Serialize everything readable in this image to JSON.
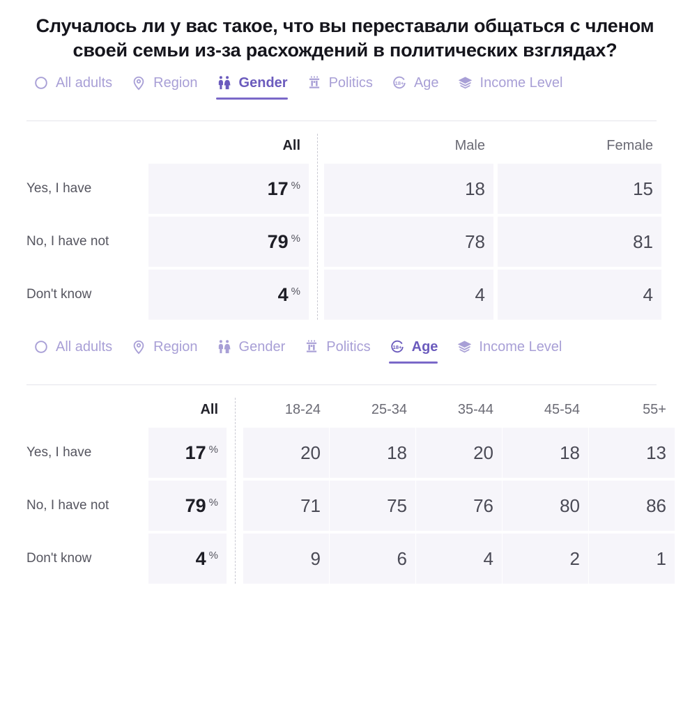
{
  "page": {
    "title": "Случалось ли у вас такое, что вы переставали общаться с членом своей семьи из-за расхождений в политических взглядах?",
    "accent_color": "#6b5bbd",
    "inactive_color": "#a89fd6",
    "cell_bg": "#f6f5fa"
  },
  "tabs": [
    {
      "label": "All adults",
      "icon": "circle-icon",
      "active": false
    },
    {
      "label": "Region",
      "icon": "map-pin-icon",
      "active": false
    },
    {
      "label": "Gender",
      "icon": "gender-people-icon",
      "active": true
    },
    {
      "label": "Politics",
      "icon": "capitol-building-icon",
      "active": false
    },
    {
      "label": "Age",
      "icon": "age-18plus-icon",
      "active": false
    },
    {
      "label": "Income Level",
      "icon": "graduation-cap-icon",
      "active": false
    }
  ],
  "tabs2": [
    {
      "label": "All adults",
      "icon": "circle-icon",
      "active": false
    },
    {
      "label": "Region",
      "icon": "map-pin-icon",
      "active": false
    },
    {
      "label": "Gender",
      "icon": "gender-people-icon",
      "active": false
    },
    {
      "label": "Politics",
      "icon": "capitol-building-icon",
      "active": false
    },
    {
      "label": "Age",
      "icon": "age-18plus-icon",
      "active": true
    },
    {
      "label": "Income Level",
      "icon": "graduation-cap-icon",
      "active": false
    }
  ],
  "gender_table": {
    "headers": {
      "all": "All",
      "male": "Male",
      "female": "Female"
    },
    "rows": [
      {
        "label": "Yes, I have",
        "all": "17",
        "pct": "%",
        "male": "18",
        "female": "15"
      },
      {
        "label": "No, I have not",
        "all": "79",
        "pct": "%",
        "male": "78",
        "female": "81"
      },
      {
        "label": "Don't know",
        "all": "4",
        "pct": "%",
        "male": "4",
        "female": "4"
      }
    ]
  },
  "age_table": {
    "headers": {
      "all": "All",
      "a": "18-24",
      "b": "25-34",
      "c": "35-44",
      "d": "45-54",
      "e": "55+"
    },
    "rows": [
      {
        "label": "Yes, I have",
        "all": "17",
        "pct": "%",
        "a": "20",
        "b": "18",
        "c": "20",
        "d": "18",
        "e": "13"
      },
      {
        "label": "No, I have not",
        "all": "79",
        "pct": "%",
        "a": "71",
        "b": "75",
        "c": "76",
        "d": "80",
        "e": "86"
      },
      {
        "label": "Don't know",
        "all": "4",
        "pct": "%",
        "a": "9",
        "b": "6",
        "c": "4",
        "d": "2",
        "e": "1"
      }
    ]
  },
  "chart_data": {
    "type": "table",
    "title": "Случалось ли у вас такое, что вы переставали общаться с членом своей семьи из-за расхождений в политических взглядах?",
    "unit": "percent",
    "tables": [
      {
        "breakdown": "Gender",
        "categories": [
          "All",
          "Male",
          "Female"
        ],
        "rows": [
          "Yes, I have",
          "No, I have not",
          "Don't know"
        ],
        "values": [
          [
            17,
            18,
            15
          ],
          [
            79,
            78,
            81
          ],
          [
            4,
            4,
            4
          ]
        ]
      },
      {
        "breakdown": "Age",
        "categories": [
          "All",
          "18-24",
          "25-34",
          "35-44",
          "45-54",
          "55+"
        ],
        "rows": [
          "Yes, I have",
          "No, I have not",
          "Don't know"
        ],
        "values": [
          [
            17,
            20,
            18,
            20,
            18,
            13
          ],
          [
            79,
            71,
            75,
            76,
            80,
            86
          ],
          [
            4,
            9,
            6,
            4,
            2,
            1
          ]
        ]
      }
    ]
  }
}
